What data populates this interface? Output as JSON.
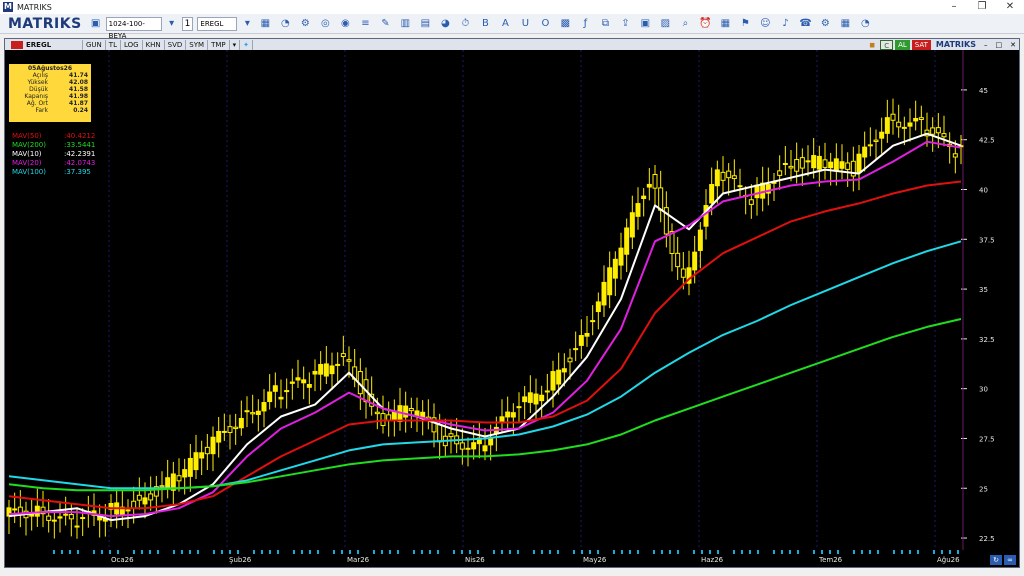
{
  "window": {
    "title": "MATRIKS",
    "logo": "M"
  },
  "toolbar": {
    "brand": "MATRIKS",
    "template": "1024-100-BEYA",
    "layout_number": "1",
    "symbol": "EREGL",
    "icons": [
      "save-icon",
      "chart-type-icon",
      "zoom-icon",
      "settings-icon",
      "compass-icon",
      "eye-icon",
      "list-icon",
      "drawing-icon",
      "pencil-icon",
      "bar-chart-icon",
      "table-icon",
      "pie-icon",
      "clock-icon",
      "b-icon",
      "a-icon",
      "u-icon",
      "circle-icon",
      "grid-icon",
      "fx-icon",
      "copy-icon",
      "export-icon",
      "news-icon",
      "chart-icon",
      "search-icon",
      "alarm-icon",
      "calendar-icon",
      "broadcast-icon",
      "user-icon",
      "bell-icon",
      "phone-icon",
      "gear-icon"
    ]
  },
  "chart": {
    "symbol_tab": "EREGL",
    "tabs": [
      "GUN",
      "TL",
      "LOG",
      "KHN",
      "SVD",
      "SYM",
      "TMP"
    ],
    "right_buttons": {
      "c": "C",
      "al": "AL",
      "sat": "SAT",
      "brand": "MATRIKS"
    },
    "info": {
      "date": "05Ağustos26",
      "rows": [
        {
          "k": "Açılış",
          "v": "41.74"
        },
        {
          "k": "Yüksek",
          "v": "42.08"
        },
        {
          "k": "Düşük",
          "v": "41.58"
        },
        {
          "k": "Kapanış",
          "v": "41.98"
        },
        {
          "k": "Ağ. Ort",
          "v": "41.87"
        },
        {
          "k": "Fark",
          "v": "0.24"
        }
      ]
    },
    "indicators": [
      {
        "name": "MAV(50)",
        "value": ":40.4212",
        "color": "#e01010"
      },
      {
        "name": "MAV(200)",
        "value": ":33.5441",
        "color": "#20dd20"
      },
      {
        "name": "MAV(10)",
        "value": ":42.2391",
        "color": "#ffffff"
      },
      {
        "name": "MAV(20)",
        "value": ":42.0743",
        "color": "#e020e0"
      },
      {
        "name": "MAV(100)",
        "value": ":37.395",
        "color": "#20d8e8"
      }
    ],
    "colors": {
      "candle": "#ffee00",
      "background": "#000000",
      "grid": "#1a1a6a",
      "axis_text": "#e8e8e8"
    }
  },
  "chart_data": {
    "type": "line",
    "title": "EREGL",
    "ylim": [
      22,
      46
    ],
    "y_ticks": [
      "22.5",
      "25",
      "27.5",
      "30",
      "32.5",
      "35",
      "37.5",
      "40",
      "42.5",
      "45"
    ],
    "x_tick_labels": [
      "Oca26",
      "Şub26",
      "Mar26",
      "Nis26",
      "May26",
      "Haz26",
      "Tem26",
      "Ağu26"
    ],
    "series": [
      {
        "name": "MAV(10)",
        "values": [
          23.6,
          23.8,
          24.0,
          23.4,
          23.6,
          24.2,
          25.2,
          27.2,
          28.6,
          29.2,
          30.8,
          29.0,
          28.6,
          28.0,
          27.6,
          28.0,
          29.6,
          31.6,
          34.5,
          39.2,
          38.0,
          39.8,
          40.2,
          40.6,
          41.0,
          40.8,
          42.2,
          42.8,
          42.2
        ]
      },
      {
        "name": "MAV(20)",
        "values": [
          23.7,
          23.8,
          23.8,
          23.6,
          23.7,
          24.0,
          24.8,
          26.6,
          28.0,
          28.8,
          29.8,
          29.0,
          28.6,
          28.2,
          27.9,
          28.0,
          28.8,
          30.4,
          33.0,
          37.4,
          38.2,
          39.4,
          39.8,
          40.2,
          40.4,
          40.5,
          41.4,
          42.4,
          42.1
        ]
      },
      {
        "name": "MAV(50)",
        "values": [
          24.6,
          24.4,
          24.2,
          24.0,
          24.0,
          24.2,
          24.6,
          25.6,
          26.6,
          27.4,
          28.2,
          28.4,
          28.4,
          28.4,
          28.3,
          28.3,
          28.6,
          29.4,
          31.0,
          33.8,
          35.5,
          36.8,
          37.6,
          38.4,
          38.9,
          39.3,
          39.8,
          40.2,
          40.4
        ]
      },
      {
        "name": "MAV(100)",
        "values": [
          25.6,
          25.4,
          25.2,
          25.0,
          25.0,
          25.0,
          25.1,
          25.4,
          25.9,
          26.4,
          26.9,
          27.2,
          27.3,
          27.4,
          27.5,
          27.7,
          28.1,
          28.7,
          29.6,
          30.8,
          31.8,
          32.7,
          33.4,
          34.2,
          34.9,
          35.6,
          36.3,
          36.9,
          37.4
        ]
      },
      {
        "name": "MAV(200)",
        "values": [
          25.2,
          25.0,
          24.9,
          24.9,
          24.9,
          25.0,
          25.1,
          25.3,
          25.6,
          25.9,
          26.2,
          26.4,
          26.5,
          26.6,
          26.6,
          26.7,
          26.9,
          27.2,
          27.7,
          28.4,
          29.0,
          29.6,
          30.2,
          30.8,
          31.4,
          32.0,
          32.6,
          33.1,
          33.5
        ]
      }
    ],
    "candles_close": [
      23.6,
      24.0,
      23.2,
      23.8,
      24.4,
      25.4,
      27.0,
      28.6,
      29.8,
      30.4,
      31.8,
      28.4,
      29.0,
      27.4,
      27.2,
      28.8,
      30.2,
      32.4,
      36.4,
      40.6,
      35.4,
      40.8,
      39.6,
      41.2,
      41.4,
      41.0,
      43.6,
      43.2,
      41.9
    ]
  }
}
